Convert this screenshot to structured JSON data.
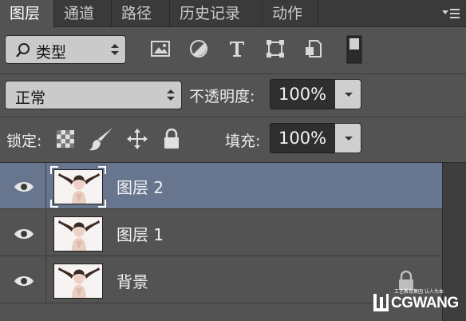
{
  "tabs": [
    {
      "label": "图层",
      "active": true
    },
    {
      "label": "通道",
      "active": false
    },
    {
      "label": "路径",
      "active": false
    },
    {
      "label": "历史记录",
      "active": false
    },
    {
      "label": "动作",
      "active": false
    }
  ],
  "filter": {
    "type_label": "类型",
    "icons": [
      "pixel-filter-icon",
      "adjustment-filter-icon",
      "type-filter-icon",
      "shape-filter-icon",
      "smart-object-filter-icon",
      "filter-toggle-icon"
    ]
  },
  "blend": {
    "mode": "正常",
    "opacity_label": "不透明度:",
    "opacity_value": "100%"
  },
  "lock": {
    "label": "锁定:",
    "icons": [
      "lock-transparent-pixels-icon",
      "lock-image-pixels-icon",
      "lock-position-icon",
      "lock-all-icon"
    ],
    "fill_label": "填充:",
    "fill_value": "100%"
  },
  "layers": [
    {
      "name": "图层 2",
      "selected": true,
      "visible": true,
      "locked": false
    },
    {
      "name": "图层 1",
      "selected": false,
      "visible": true,
      "locked": false
    },
    {
      "name": "背景",
      "selected": false,
      "visible": true,
      "locked": true
    }
  ],
  "watermark": {
    "small_text": "工艺教育集团 认人为本",
    "brand": "CGWANG"
  },
  "colors": {
    "panel_bg": "#535353",
    "tab_bar_bg": "#3a3a3a",
    "selected_layer": "#67758f",
    "field_bg": "#2f2f2f",
    "dropdown_bg": "#cacaca"
  }
}
